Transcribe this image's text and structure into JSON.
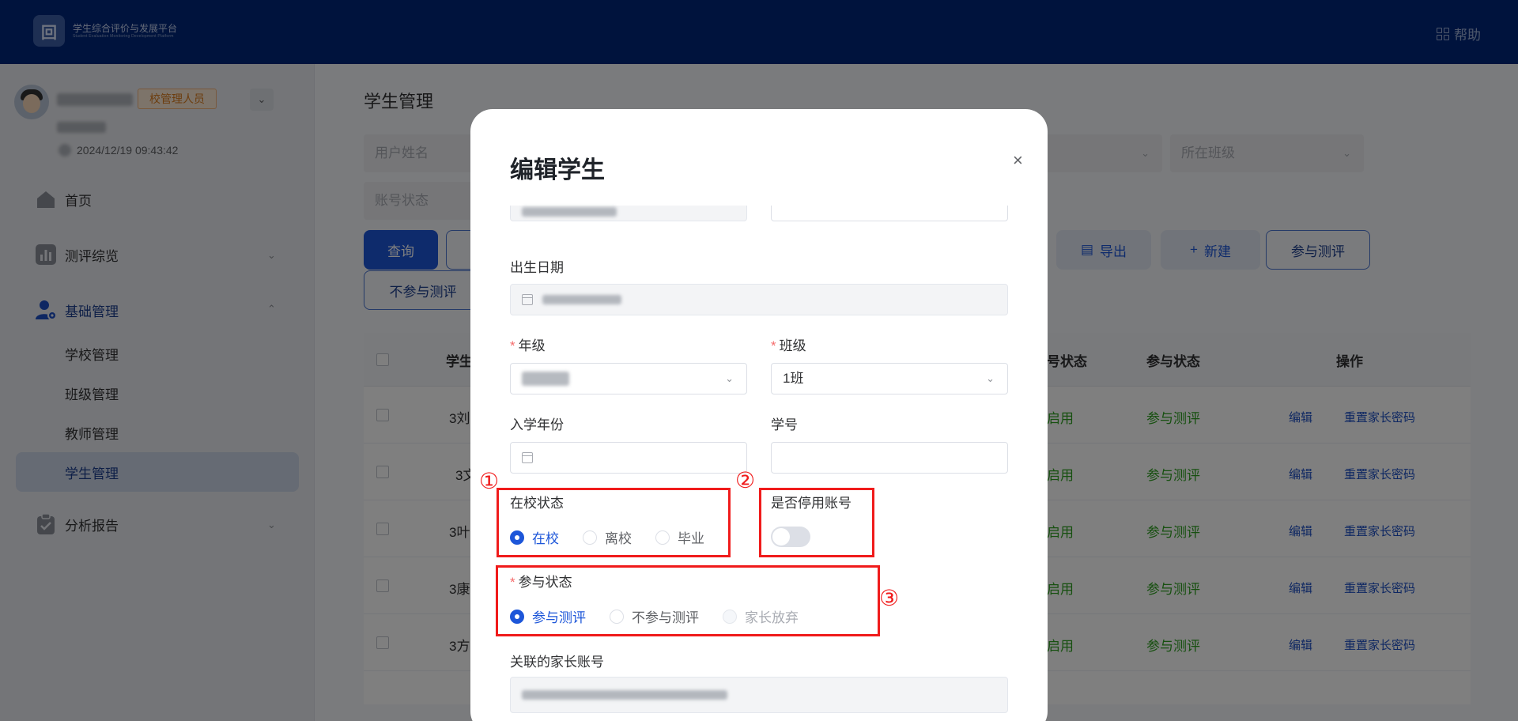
{
  "topbar": {
    "logo_mark": "回",
    "logo_title": "学生综合评价与发展平台",
    "logo_subtitle": "Student Evaluation Monitoring Development Platform",
    "help_label": "帮助"
  },
  "user": {
    "role_tag": "校管理人员",
    "login_time": "2024/12/19 09:43:42"
  },
  "sidebar": {
    "items": [
      {
        "label": "首页"
      },
      {
        "label": "测评综览"
      },
      {
        "label": "基础管理"
      },
      {
        "label": "分析报告"
      }
    ],
    "sub_items": [
      {
        "label": "学校管理"
      },
      {
        "label": "班级管理"
      },
      {
        "label": "教师管理"
      },
      {
        "label": "学生管理"
      }
    ]
  },
  "main": {
    "title": "学生管理",
    "filters": {
      "name_placeholder": "用户姓名",
      "class_placeholder": "所在班级",
      "account_status_placeholder": "账号状态"
    },
    "buttons": {
      "query": "查询",
      "export": "导出",
      "new": "新建",
      "participate": "参与测评",
      "not_participate": "不参与测评"
    },
    "table": {
      "headers": {
        "student": "学生",
        "account_status": "号状态",
        "participation": "参与状态",
        "actions": "操作"
      },
      "rows": [
        {
          "name": "3刘",
          "status": "启用",
          "participation": "参与测评",
          "edit": "编辑",
          "reset": "重置家长密码"
        },
        {
          "name": "3文",
          "status": "启用",
          "participation": "参与测评",
          "edit": "编辑",
          "reset": "重置家长密码"
        },
        {
          "name": "3叶",
          "status": "启用",
          "participation": "参与测评",
          "edit": "编辑",
          "reset": "重置家长密码"
        },
        {
          "name": "3康",
          "status": "启用",
          "participation": "参与测评",
          "edit": "编辑",
          "reset": "重置家长密码"
        },
        {
          "name": "3方",
          "status": "启用",
          "participation": "参与测评",
          "edit": "编辑",
          "reset": "重置家长密码"
        }
      ]
    }
  },
  "modal": {
    "title": "编辑学生",
    "close": "×",
    "birth_date_label": "出生日期",
    "grade_label": "年级",
    "class_label": "班级",
    "class_value": "1班",
    "enroll_year_label": "入学年份",
    "student_no_label": "学号",
    "school_status": {
      "label": "在校状态",
      "options": [
        "在校",
        "离校",
        "毕业"
      ],
      "selected": "在校"
    },
    "disable_account": {
      "label": "是否停用账号",
      "on": false
    },
    "participation": {
      "label": "参与状态",
      "options": [
        "参与测评",
        "不参与测评",
        "家长放弃"
      ],
      "selected": "参与测评"
    },
    "parent_account_label": "关联的家长账号"
  },
  "annotations": [
    "①",
    "②",
    "③"
  ],
  "colors": {
    "topbar": "#00277a",
    "primary": "#1d56d9",
    "annotation": "#f01b1b",
    "success": "#2ea121"
  }
}
